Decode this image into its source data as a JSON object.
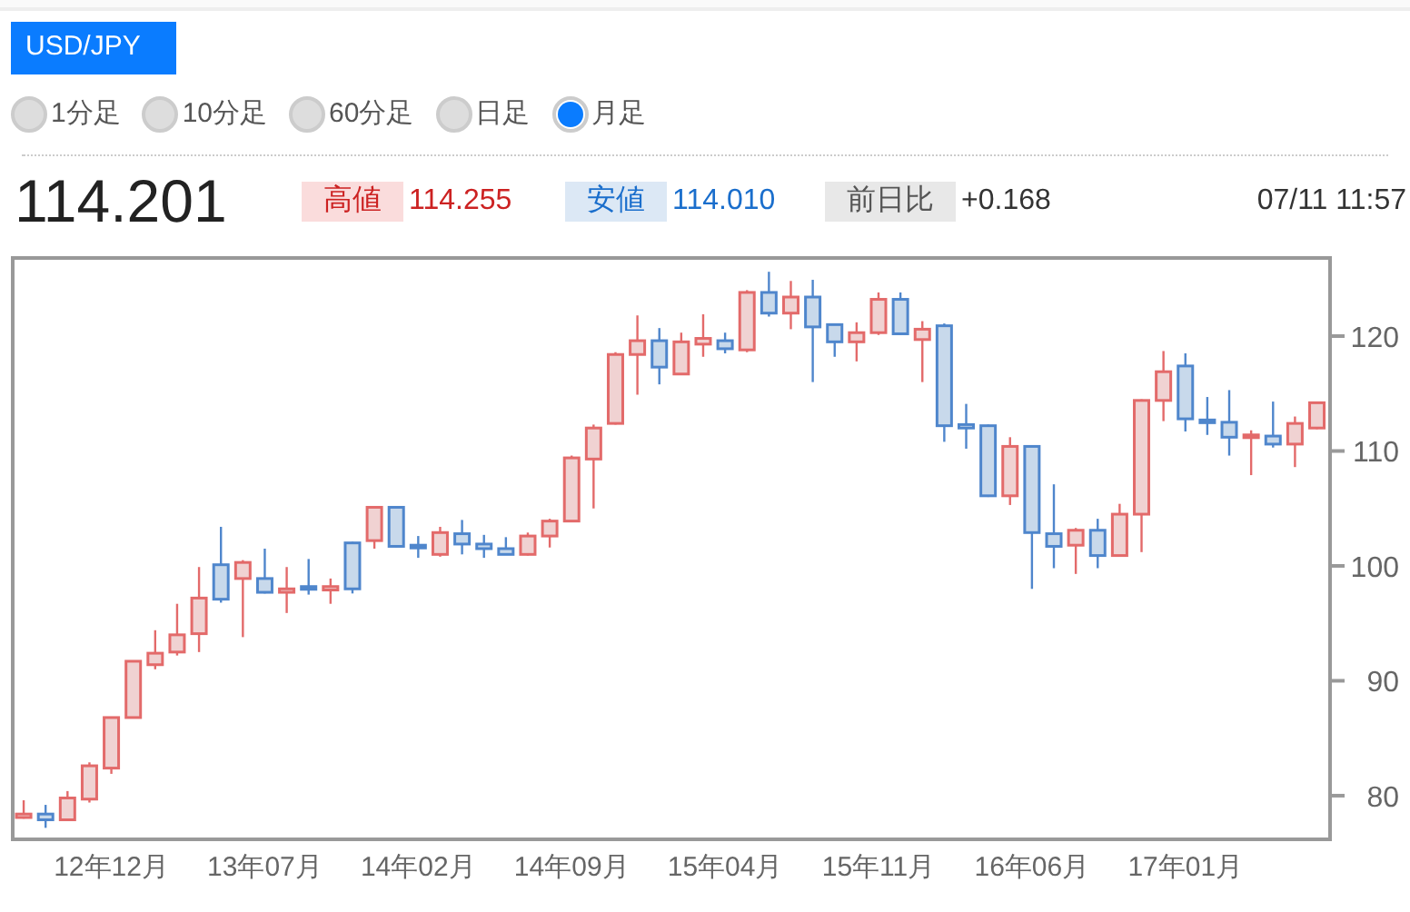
{
  "pair_button": {
    "label": "USD/JPY"
  },
  "periods": [
    {
      "label": "1分足",
      "selected": false
    },
    {
      "label": "10分足",
      "selected": false
    },
    {
      "label": "60分足",
      "selected": false
    },
    {
      "label": "日足",
      "selected": false
    },
    {
      "label": "月足",
      "selected": true
    }
  ],
  "quote": {
    "price": "114.201",
    "stats": [
      {
        "kind": "high",
        "label": "高値",
        "value": "114.255"
      },
      {
        "kind": "low",
        "label": "安値",
        "value": "114.010"
      },
      {
        "kind": "change",
        "label": "前日比",
        "value": "+0.168"
      }
    ],
    "timestamp": "07/11 11:57"
  },
  "chart": {
    "chart_data": {
      "type": "candlestick",
      "ylim": [
        76.2,
        126.8
      ],
      "yticks": [
        80,
        90,
        100,
        110,
        120
      ],
      "categories": [
        null,
        null,
        null,
        null,
        "12年12月",
        null,
        null,
        null,
        null,
        null,
        null,
        "13年07月",
        null,
        null,
        null,
        null,
        null,
        null,
        "14年02月",
        null,
        null,
        null,
        null,
        null,
        null,
        "14年09月",
        null,
        null,
        null,
        null,
        null,
        null,
        "15年04月",
        null,
        null,
        null,
        null,
        null,
        null,
        "15年11月",
        null,
        null,
        null,
        null,
        null,
        null,
        "16年06月",
        null,
        null,
        null,
        null,
        null,
        null,
        "17年01月",
        null,
        null,
        null,
        null,
        null,
        null
      ],
      "ohlc": [
        [
          78.1,
          79.6,
          78.0,
          78.4
        ],
        [
          78.4,
          79.2,
          77.2,
          77.9
        ],
        [
          77.9,
          80.4,
          77.8,
          79.8
        ],
        [
          79.7,
          82.9,
          79.4,
          82.6
        ],
        [
          82.4,
          86.8,
          81.9,
          86.8
        ],
        [
          86.8,
          91.7,
          86.8,
          91.7
        ],
        [
          91.4,
          94.4,
          91.0,
          92.4
        ],
        [
          92.5,
          96.7,
          92.2,
          94.0
        ],
        [
          94.1,
          99.9,
          92.5,
          97.2
        ],
        [
          100.1,
          103.4,
          96.8,
          97.1
        ],
        [
          98.9,
          100.5,
          93.8,
          100.3
        ],
        [
          98.9,
          101.5,
          97.6,
          97.7
        ],
        [
          97.7,
          99.9,
          95.9,
          98.0
        ],
        [
          98.2,
          100.6,
          97.5,
          98.0
        ],
        [
          97.9,
          98.9,
          96.7,
          98.2
        ],
        [
          102.0,
          102.1,
          97.6,
          98.0
        ],
        [
          102.2,
          105.2,
          101.5,
          105.1
        ],
        [
          105.1,
          105.2,
          101.6,
          101.7
        ],
        [
          101.8,
          102.6,
          100.7,
          101.6
        ],
        [
          101.0,
          103.4,
          100.8,
          102.9
        ],
        [
          102.8,
          104.0,
          101.0,
          101.9
        ],
        [
          101.9,
          102.7,
          100.7,
          101.5
        ],
        [
          101.5,
          102.5,
          101.0,
          101.0
        ],
        [
          101.0,
          102.9,
          100.9,
          102.6
        ],
        [
          102.6,
          104.1,
          101.6,
          103.9
        ],
        [
          103.9,
          109.6,
          103.8,
          109.4
        ],
        [
          109.3,
          112.3,
          105.0,
          112.0
        ],
        [
          112.4,
          118.6,
          112.3,
          118.4
        ],
        [
          118.4,
          121.8,
          114.9,
          119.6
        ],
        [
          119.6,
          120.7,
          115.8,
          117.3
        ],
        [
          116.7,
          120.3,
          116.6,
          119.5
        ],
        [
          119.3,
          121.9,
          118.2,
          119.8
        ],
        [
          119.6,
          120.3,
          118.5,
          118.9
        ],
        [
          118.8,
          124.0,
          118.6,
          123.8
        ],
        [
          123.8,
          125.6,
          121.7,
          122.0
        ],
        [
          122.0,
          124.8,
          120.6,
          123.4
        ],
        [
          123.4,
          124.9,
          116.0,
          120.8
        ],
        [
          121.0,
          121.1,
          118.2,
          119.5
        ],
        [
          119.5,
          121.2,
          117.8,
          120.3
        ],
        [
          120.3,
          123.8,
          120.1,
          123.2
        ],
        [
          123.2,
          123.8,
          120.1,
          120.2
        ],
        [
          119.7,
          121.3,
          116.0,
          120.6
        ],
        [
          120.9,
          121.1,
          110.8,
          112.2
        ],
        [
          112.3,
          114.1,
          110.2,
          112.0
        ],
        [
          112.2,
          112.3,
          106.0,
          106.1
        ],
        [
          106.1,
          111.2,
          105.3,
          110.4
        ],
        [
          110.4,
          110.5,
          98.0,
          102.9
        ],
        [
          102.8,
          107.1,
          99.8,
          101.7
        ],
        [
          101.8,
          103.3,
          99.3,
          103.1
        ],
        [
          103.1,
          104.1,
          99.8,
          100.9
        ],
        [
          100.9,
          105.4,
          100.8,
          104.5
        ],
        [
          104.5,
          114.5,
          101.2,
          114.4
        ],
        [
          114.4,
          118.7,
          112.6,
          116.9
        ],
        [
          117.4,
          118.5,
          111.7,
          112.8
        ],
        [
          112.7,
          114.7,
          111.4,
          112.5
        ],
        [
          112.5,
          115.3,
          109.6,
          111.2
        ],
        [
          111.2,
          111.8,
          107.9,
          111.4
        ],
        [
          111.3,
          114.3,
          110.3,
          110.6
        ],
        [
          110.6,
          113.0,
          108.6,
          112.4
        ],
        [
          112.0,
          114.3,
          111.9,
          114.2
        ]
      ]
    }
  }
}
